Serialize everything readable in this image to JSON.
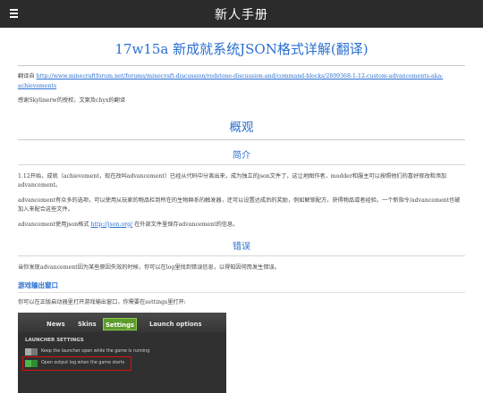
{
  "app": {
    "title": "新人手册"
  },
  "page": {
    "title": "17w15a 新成就系统JSON格式详解(翻译)",
    "translation_prefix": "翻译自 ",
    "translation_url": "http://www.minecraftforum.net/forums/minecraft-discussion/redstone-discussion-and/command-blocks/2809368-1-12-custom-advancements-aka-achievements",
    "credit": "感谢Skylinerw的授权，文案及chyx的翻译"
  },
  "overview": {
    "heading": "概观",
    "intro_heading": "简介",
    "intro_p1": "1.12开始，成就（achievement，现在改叫advancement）已经从代码中分离出来，成为独立的json文件了，这让地图作者，modder和服主可以按照他们的喜好修改和添加advancement。",
    "intro_p2": "advancement有众多的选项，可以使用从玩家的物品栏到所在的生物群系的触发器，还可以设置达成后的奖励，例如解锁配方，获得物品或者经验。一个新指令/advancement也被加入来配合这些文件。",
    "intro_p3_prefix": "advancement使用json格式 ",
    "intro_p3_link": "http://json.org/",
    "intro_p3_suffix": " 在外部文件里保存advancement的信息。"
  },
  "errors": {
    "heading": "错误",
    "text": "当你发现advancement因为某些原因失效的时候，你可以在log里找到错误信息，以得知因何而发生错误。",
    "output_heading": "游戏输出窗口",
    "output_text": "你可以在正版启动器里打开游戏输出窗口，你需要在settings里打开:"
  },
  "launcher_shot": {
    "tabs": [
      "News",
      "Skins",
      "Settings",
      "Launch options"
    ],
    "section": "LAUNCHER SETTINGS",
    "row1": "Keep the launcher open while the game is running",
    "row2": "Open output log when the game starts",
    "colors": {
      "active_tab": "#5e9b2e",
      "highlight": "#dd1111",
      "toggle_on": "#4bb84b"
    }
  },
  "colors": {
    "accent": "#2a6fd0",
    "topbar": "#2b2b2b"
  }
}
